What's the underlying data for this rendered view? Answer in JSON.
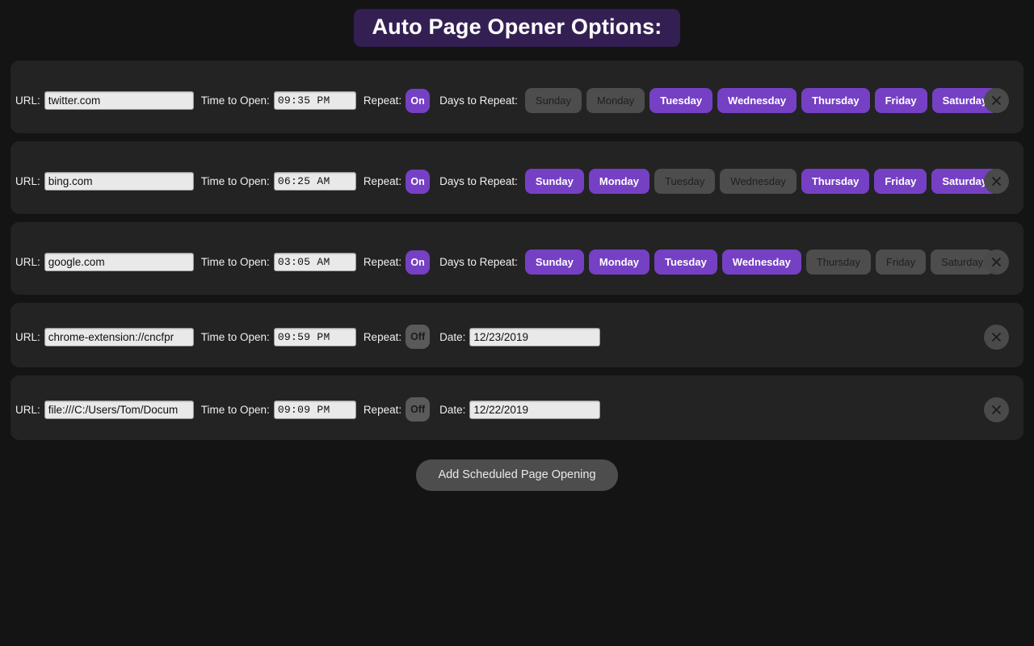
{
  "header": {
    "title": "Auto Page Opener Options:",
    "accent_color": "#331f52"
  },
  "colors": {
    "page_background": "#141414",
    "card_background": "#232323",
    "selected_purple": "#7540c4",
    "unselected_gray": "#4d4d4d",
    "input_background": "#e9e9e9"
  },
  "labels": {
    "url": "URL:",
    "time_to_open": "Time to Open:",
    "repeat": "Repeat:",
    "days_to_repeat": "Days to Repeat:",
    "date": "Date:"
  },
  "day_names": [
    "Sunday",
    "Monday",
    "Tuesday",
    "Wednesday",
    "Thursday",
    "Friday",
    "Saturday"
  ],
  "schedules": [
    {
      "url": "twitter.com",
      "time": "09:35 PM",
      "repeat": "On",
      "repeat_on": true,
      "days_selected": [
        false,
        false,
        true,
        true,
        true,
        true,
        true
      ],
      "date": null
    },
    {
      "url": "bing.com",
      "time": "06:25 AM",
      "repeat": "On",
      "repeat_on": true,
      "days_selected": [
        true,
        true,
        false,
        false,
        true,
        true,
        true
      ],
      "date": null
    },
    {
      "url": "google.com",
      "time": "03:05 AM",
      "repeat": "On",
      "repeat_on": true,
      "days_selected": [
        true,
        true,
        true,
        true,
        false,
        false,
        false
      ],
      "date": null
    },
    {
      "url": "chrome-extension://cncfpr",
      "time": "09:59 PM",
      "repeat": "Off",
      "repeat_on": false,
      "days_selected": null,
      "date": "12/23/2019"
    },
    {
      "url": "file:///C:/Users/Tom/Docum",
      "time": "09:09 PM",
      "repeat": "Off",
      "repeat_on": false,
      "days_selected": null,
      "date": "12/22/2019"
    }
  ],
  "footer": {
    "add_button_label": "Add Scheduled Page Opening"
  },
  "icons": {
    "remove": "close-icon"
  }
}
